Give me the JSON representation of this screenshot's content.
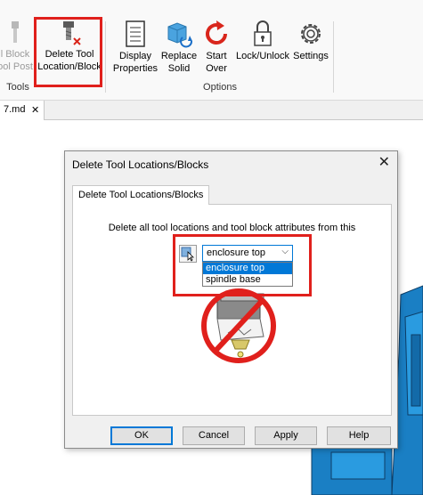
{
  "ribbon": {
    "partial_button": {
      "line1": "l Block",
      "line2": "ool Post"
    },
    "tools_group_label": "Tools",
    "delete_tool_button": {
      "line1": "Delete Tool",
      "line2": "Location/Block"
    },
    "display_button": {
      "line1": "Display",
      "line2": "Properties"
    },
    "replace_button": {
      "line1": "Replace",
      "line2": "Solid"
    },
    "start_over_button": {
      "line1": "Start",
      "line2": "Over"
    },
    "lock_button": {
      "line1": "Lock/Unlock"
    },
    "settings_button": {
      "line1": "Settings"
    },
    "options_group_label": "Options"
  },
  "doc_tab": {
    "label": "7.md",
    "close": "✕"
  },
  "dialog": {
    "title": "Delete Tool Locations/Blocks",
    "close": "✕",
    "tab_label": "Delete Tool Locations/Blocks",
    "description": "Delete all tool locations and tool block attributes from this",
    "combo": {
      "selected": "enclosure top",
      "options": [
        "enclosure top",
        "spindle base"
      ]
    },
    "buttons": {
      "ok": "OK",
      "cancel": "Cancel",
      "apply": "Apply",
      "help": "Help"
    }
  },
  "colors": {
    "highlight": "#e0201c",
    "accent": "#0078d7",
    "no_sign": "#e0201c"
  }
}
